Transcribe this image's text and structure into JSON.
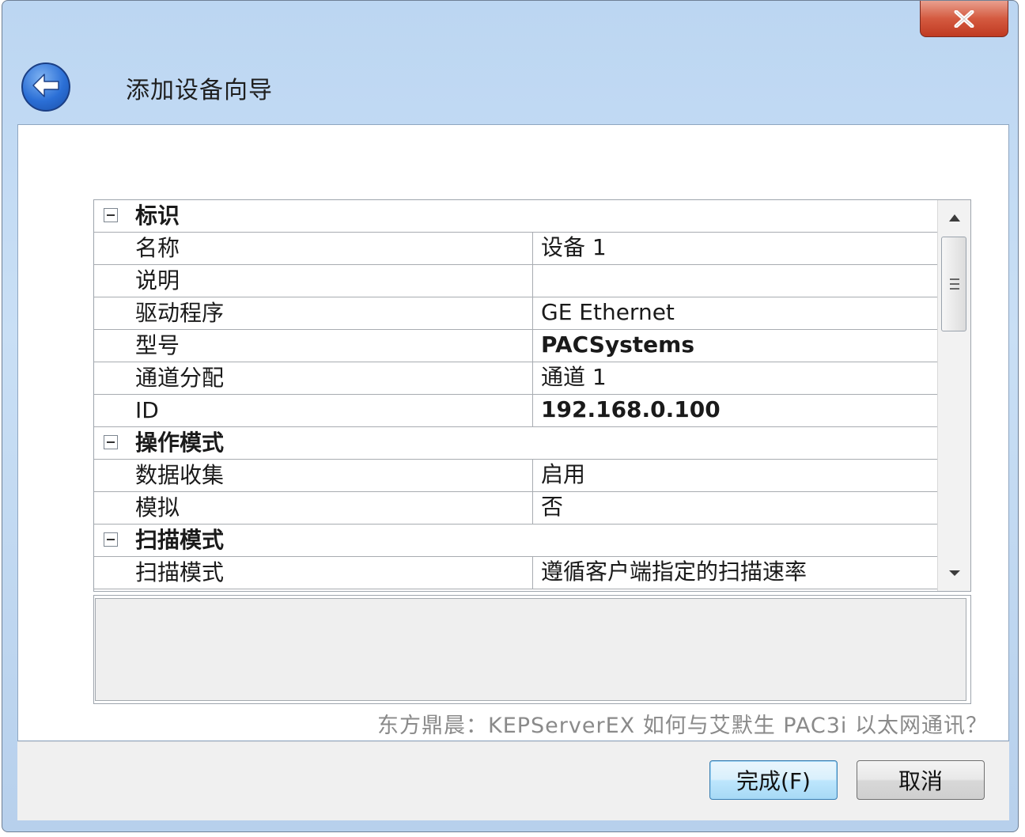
{
  "window": {
    "title": "添加设备向导",
    "close_label": "X"
  },
  "properties": {
    "groups": [
      {
        "label": "标识",
        "rows": [
          {
            "name": "名称",
            "value": "设备 1",
            "bold": false
          },
          {
            "name": "说明",
            "value": "",
            "bold": false
          },
          {
            "name": "驱动程序",
            "value": "GE Ethernet",
            "bold": false
          },
          {
            "name": "型号",
            "value": "PACSystems",
            "bold": true
          },
          {
            "name": "通道分配",
            "value": "通道 1",
            "bold": false
          },
          {
            "name": "ID",
            "value": "192.168.0.100",
            "bold": true
          }
        ]
      },
      {
        "label": "操作模式",
        "rows": [
          {
            "name": "数据收集",
            "value": "启用",
            "bold": false
          },
          {
            "name": "模拟",
            "value": "否",
            "bold": false
          }
        ]
      },
      {
        "label": "扫描模式",
        "rows": [
          {
            "name": "扫描模式",
            "value": "遵循客户端指定的扫描速率",
            "bold": false
          }
        ]
      }
    ]
  },
  "caption": "东方鼎晨：KEPServerEX 如何与艾默生 PAC3i 以太网通讯？",
  "buttons": {
    "finish": "完成(F)",
    "cancel": "取消"
  },
  "icons": {
    "back": "back-arrow-icon",
    "close": "close-icon",
    "collapse": "minus-box-icon"
  }
}
